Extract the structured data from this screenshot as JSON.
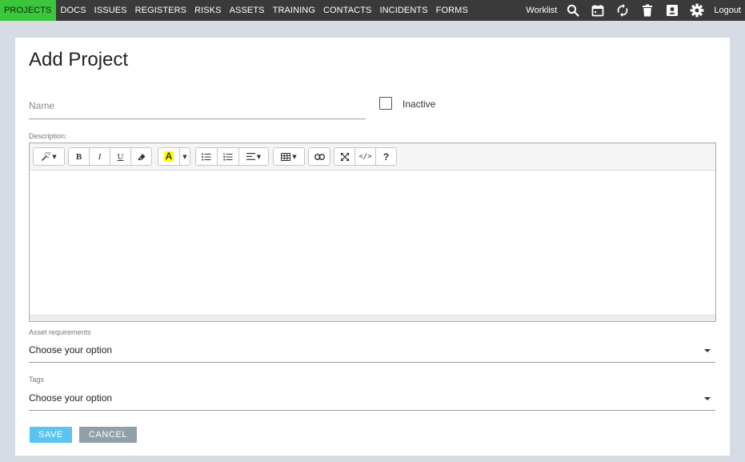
{
  "nav": {
    "items": [
      "PROJECTS",
      "DOCS",
      "ISSUES",
      "REGISTERS",
      "RISKS",
      "ASSETS",
      "TRAINING",
      "CONTACTS",
      "INCIDENTS",
      "FORMS"
    ],
    "active": "PROJECTS",
    "worklist": "Worklist",
    "icons": [
      "search-icon",
      "calendar-icon",
      "refresh-icon",
      "trash-icon",
      "contact-card-icon",
      "gear-icon"
    ],
    "logout": "Logout"
  },
  "form": {
    "title": "Add Project",
    "name_placeholder": "Name",
    "inactive_label": "Inactive",
    "description_label": "Description:",
    "asset_requirements_label": "Asset requirements",
    "asset_requirements_value": "Choose your option",
    "tags_label": "Tags",
    "tags_value": "Choose your option",
    "save": "SAVE",
    "cancel": "CANCEL"
  },
  "editor_toolbar": {
    "bold": "B",
    "italic": "I",
    "underline": "U",
    "color": "A",
    "help": "?",
    "codeview": "</>"
  },
  "colors": {
    "nav_bg": "#3a3a3a",
    "nav_active": "#3cc63c",
    "save_button": "#58c4ef",
    "cancel_button": "#909fa8",
    "page_bg": "#d7dce4"
  }
}
